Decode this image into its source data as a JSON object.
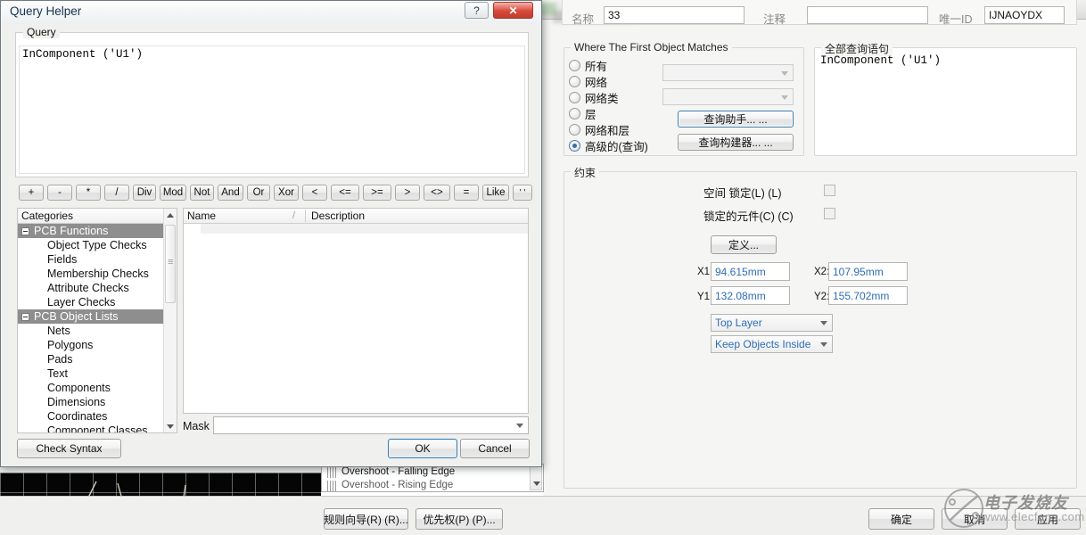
{
  "background": {
    "rules_list": [
      {
        "label": "Overshoot - Falling Edge",
        "dim": false
      },
      {
        "label": "Overshoot - Rising Edge",
        "dim": true
      }
    ],
    "bottom_left_buttons": [
      {
        "name": "rule-wizard-button",
        "label": "规则向导(R) (R)..."
      },
      {
        "name": "priorities-button",
        "label": "优先权(P) (P)..."
      }
    ],
    "bottom_right_buttons": [
      {
        "name": "ok-button",
        "label": "确定"
      },
      {
        "name": "cancel-button",
        "label": "取消"
      },
      {
        "name": "apply-button",
        "label": "应用"
      }
    ]
  },
  "watermark": {
    "brand": "电子发烧友",
    "url": "www.elecfans.com"
  },
  "query_helper": {
    "title": "Query Helper",
    "titlebar_buttons": [
      {
        "name": "help-button",
        "label": "?"
      },
      {
        "name": "close-button",
        "label": "✕"
      }
    ],
    "query_group_label": "Query",
    "query_text": "InComponent ('U1')",
    "operators": [
      "+",
      "-",
      "*",
      "/",
      "Div",
      "Mod",
      "Not",
      "And",
      "Or",
      "Xor",
      "<",
      "<=",
      ">=",
      ">",
      "<>",
      "=",
      "Like",
      "' '"
    ],
    "categories_header": "Categories",
    "categories_sort_mark": "/",
    "categories": [
      {
        "label": "PCB Functions",
        "type": "group",
        "selected": true
      },
      {
        "label": "Object Type Checks",
        "type": "child"
      },
      {
        "label": "Fields",
        "type": "child"
      },
      {
        "label": "Membership Checks",
        "type": "child"
      },
      {
        "label": "Attribute Checks",
        "type": "child"
      },
      {
        "label": "Layer Checks",
        "type": "child"
      },
      {
        "label": "PCB Object Lists",
        "type": "group",
        "selected": true
      },
      {
        "label": "Nets",
        "type": "child"
      },
      {
        "label": "Polygons",
        "type": "child"
      },
      {
        "label": "Pads",
        "type": "child"
      },
      {
        "label": "Text",
        "type": "child"
      },
      {
        "label": "Components",
        "type": "child"
      },
      {
        "label": "Dimensions",
        "type": "child"
      },
      {
        "label": "Coordinates",
        "type": "child"
      },
      {
        "label": "Component Classes",
        "type": "child"
      }
    ],
    "list_columns": [
      {
        "label": "Name",
        "sort_mark": "/"
      },
      {
        "label": "Description"
      }
    ],
    "list_rows": [],
    "mask_label": "Mask",
    "mask_value": "",
    "check_syntax_label": "Check Syntax",
    "ok_label": "OK",
    "cancel_label": "Cancel"
  },
  "rule_editor": {
    "name_label": "名称",
    "name_value": "33",
    "comment_label": "注释",
    "comment_value": "",
    "unique_id_label": "唯一ID",
    "unique_id_value": "IJNAOYDX",
    "match_group_label": "Where The First Object Matches",
    "match_options": [
      {
        "label": "所有",
        "selected": false
      },
      {
        "label": "网络",
        "selected": false
      },
      {
        "label": "网络类",
        "selected": false
      },
      {
        "label": "层",
        "selected": false
      },
      {
        "label": "网络和层",
        "selected": false
      },
      {
        "label": "高级的(查询)",
        "selected": true
      }
    ],
    "net_combo_value": "",
    "netclass_combo_value": "",
    "query_helper_button": "查询助手... ...",
    "query_builder_button": "查询构建器... ...",
    "full_query_group_label": "全部查询语句",
    "full_query_text": "InComponent ('U1')",
    "constraints_group_label": "约束",
    "constraints": {
      "room_locked_label": "空间 锁定(L) (L)",
      "room_locked_checked": false,
      "components_locked_label": "锁定的元件(C) (C)",
      "components_locked_checked": false,
      "define_button": "定义...",
      "x1_label": "X1:",
      "x1_value": "94.615mm",
      "x2_label": "X2:",
      "x2_value": "107.95mm",
      "y1_label": "Y1:",
      "y1_value": "132.08mm",
      "y2_label": "Y2:",
      "y2_value": "155.702mm",
      "layer_value": "Top Layer",
      "keep_value": "Keep Objects Inside"
    }
  },
  "colors": {
    "accent_blue": "#2f6cb5",
    "close_red": "#c23b2c",
    "group_gray": "#9a9a9a"
  }
}
